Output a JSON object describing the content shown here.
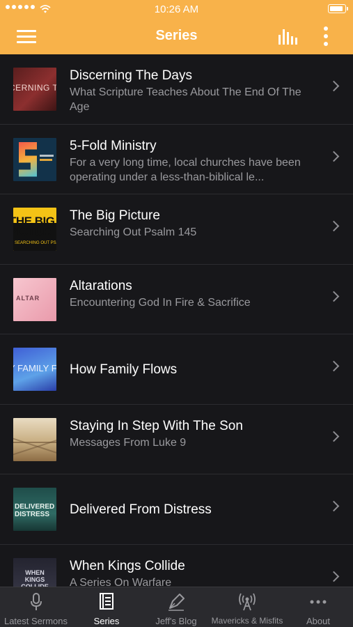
{
  "status": {
    "time": "10:26 AM"
  },
  "header": {
    "title": "Series"
  },
  "series": [
    {
      "title": "Discerning The Days",
      "subtitle": "What Scripture Teaches About The End Of The Age",
      "thumb_text": "CERNING THE D"
    },
    {
      "title": "5-Fold Ministry",
      "subtitle": "For a very long time, local churches have been operating under a less-than-biblical le...",
      "thumb_text": "5"
    },
    {
      "title": "The Big Picture",
      "subtitle": "Searching Out Psalm 145",
      "thumb_text": "THE BIG PICTUR"
    },
    {
      "title": "Altarations",
      "subtitle": "Encountering God In Fire & Sacrifice",
      "thumb_text": "ALTAR"
    },
    {
      "title": "How Family Flows",
      "subtitle": "",
      "thumb_text": "Y FAMILY FL"
    },
    {
      "title": "Staying In Step With The Son",
      "subtitle": "Messages From Luke 9",
      "thumb_text": ""
    },
    {
      "title": "Delivered From Distress",
      "subtitle": "",
      "thumb_text": "DELIVERED DISTRESS"
    },
    {
      "title": "When Kings Collide",
      "subtitle": "A Series On Warfare",
      "thumb_text": "WHEN KINGS COLLIDE"
    }
  ],
  "tabs": [
    {
      "label": "Latest Sermons",
      "icon": "microphone-icon"
    },
    {
      "label": "Series",
      "icon": "book-icon"
    },
    {
      "label": "Jeff's Blog",
      "icon": "pen-icon"
    },
    {
      "label": "Mavericks & Misfits",
      "icon": "broadcast-icon"
    },
    {
      "label": "About",
      "icon": "more-dots-icon"
    }
  ],
  "colors": {
    "accent": "#f8b24a",
    "background": "#17171a",
    "tabbar": "#2a2a2e"
  }
}
